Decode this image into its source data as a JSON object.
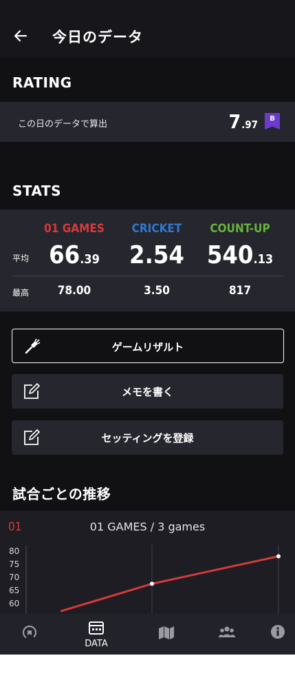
{
  "header": {
    "title": "今日のデータ",
    "back_icon": "arrow-left-icon"
  },
  "rating": {
    "section_title": "RATING",
    "label": "この日のデータで算出",
    "value_int": "7",
    "value_dec": ".97",
    "badge": "B",
    "badge_color": "#6b3cc9"
  },
  "stats": {
    "section_title": "STATS",
    "row_labels": {
      "avg": "平均",
      "max": "最高"
    },
    "columns": [
      {
        "name": "01 GAMES",
        "color": "#d63a3a",
        "avg_int": "66",
        "avg_dec": ".39",
        "max": "78.00"
      },
      {
        "name": "CRICKET",
        "color": "#2f78d0",
        "avg_int": "2.54",
        "avg_dec": "",
        "max": "3.50"
      },
      {
        "name": "COUNT-UP",
        "color": "#67b43b",
        "avg_int": "540",
        "avg_dec": ".13",
        "max": "817"
      }
    ]
  },
  "buttons": {
    "game_result": "ゲームリザルト",
    "write_memo": "メモを書く",
    "register_setting": "セッティングを登録"
  },
  "trend": {
    "section_title": "試合ごとの推移",
    "tag": "01",
    "title": "01 GAMES / 3 games"
  },
  "chart_data": {
    "type": "line",
    "title": "01 GAMES / 3 games",
    "x": [
      1,
      2,
      3
    ],
    "series": [
      {
        "values": [
          57,
          67.5,
          78
        ],
        "color": "#d63a3a"
      }
    ],
    "ylim": [
      56,
      81
    ],
    "yticks": [
      "80",
      "75",
      "70",
      "65",
      "60"
    ],
    "grid": true
  },
  "nav": {
    "items": [
      {
        "label": "",
        "icon": "rating-gauge-icon"
      },
      {
        "label": "DATA",
        "icon": "calendar-icon"
      },
      {
        "label": "",
        "icon": "map-icon"
      },
      {
        "label": "",
        "icon": "friends-icon"
      },
      {
        "label": "",
        "icon": "info-icon"
      }
    ]
  }
}
